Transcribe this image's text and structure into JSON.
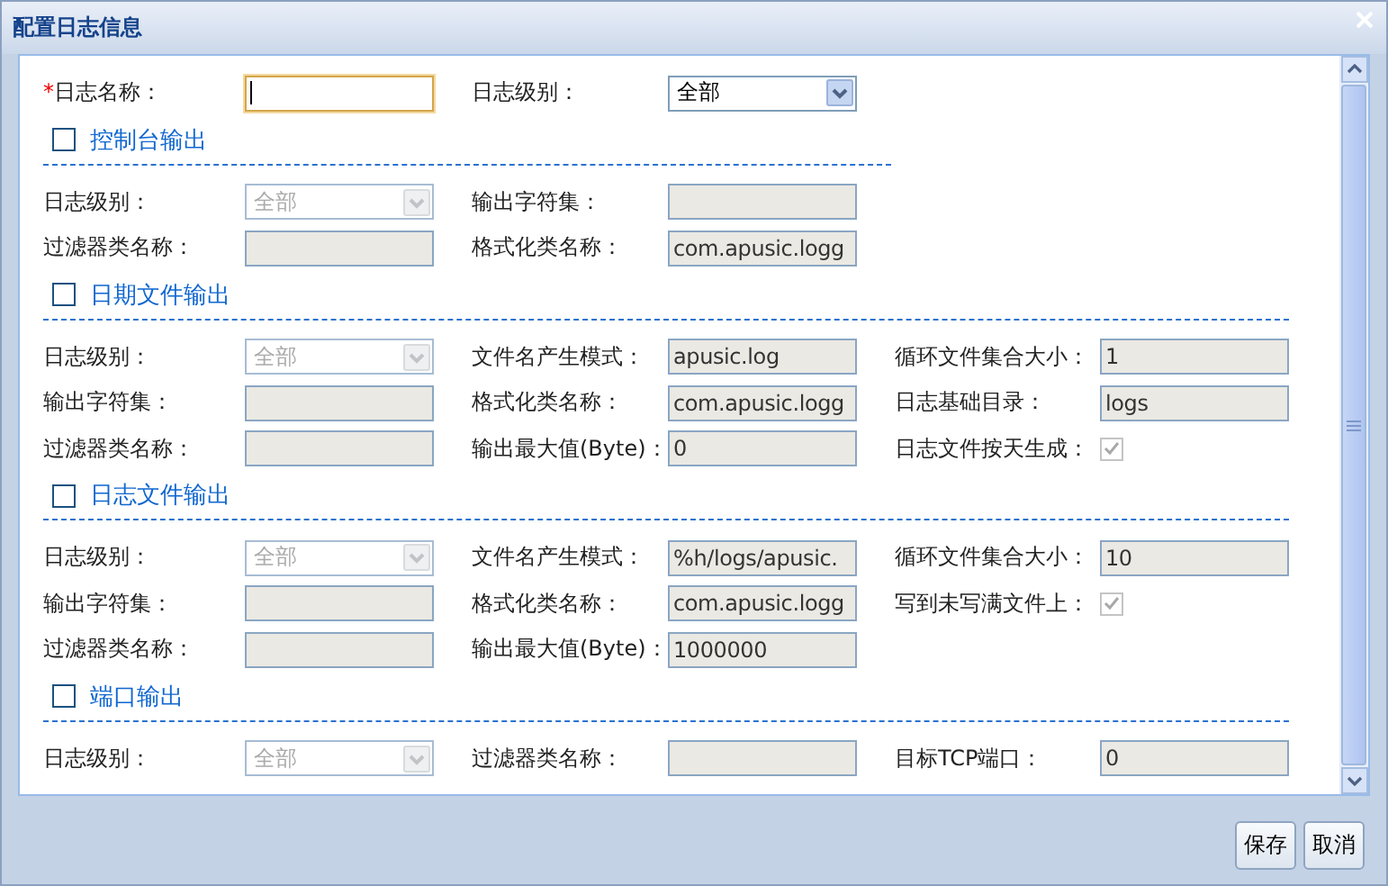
{
  "window": {
    "title": "配置日志信息"
  },
  "name_field": {
    "label": "日志名称：",
    "required_mark": "*",
    "focused": true
  },
  "level_select": {
    "label": "日志级别：",
    "value": "全部"
  },
  "sections": [
    {
      "title": "控制台输出",
      "checked": false,
      "rows": [
        [
          {
            "kind": "select",
            "label": "日志级别：",
            "value": "全部",
            "disabled": true
          },
          {
            "kind": "text",
            "label": "输出字符集：",
            "disabled": true
          }
        ],
        [
          {
            "kind": "text",
            "label": "过滤器类名称：",
            "disabled": true
          },
          {
            "kind": "text",
            "label": "格式化类名称：",
            "value": "com.apusic.logg",
            "disabled": true
          }
        ]
      ]
    },
    {
      "title": "日期文件输出",
      "checked": false,
      "rows": [
        [
          {
            "kind": "select",
            "label": "日志级别：",
            "value": "全部",
            "disabled": true
          },
          {
            "kind": "text",
            "label": "文件名产生模式：",
            "value": "apusic.log",
            "disabled": true
          },
          {
            "kind": "text",
            "label": "循环文件集合大小：",
            "value": "1",
            "disabled": true
          }
        ],
        [
          {
            "kind": "text",
            "label": "输出字符集：",
            "disabled": true
          },
          {
            "kind": "text",
            "label": "格式化类名称：",
            "value": "com.apusic.logg",
            "disabled": true
          },
          {
            "kind": "text",
            "label": "日志基础目录：",
            "value": "logs",
            "disabled": true
          }
        ],
        [
          {
            "kind": "text",
            "label": "过滤器类名称：",
            "disabled": true
          },
          {
            "kind": "text",
            "label": "输出最大值(Byte)：",
            "value": "0",
            "disabled": true
          },
          {
            "kind": "checkbox",
            "label": "日志文件按天生成：",
            "checked": true,
            "disabled": true
          }
        ]
      ]
    },
    {
      "title": "日志文件输出",
      "checked": false,
      "rows": [
        [
          {
            "kind": "select",
            "label": "日志级别：",
            "value": "全部",
            "disabled": true
          },
          {
            "kind": "text",
            "label": "文件名产生模式：",
            "value": "%h/logs/apusic.",
            "disabled": true
          },
          {
            "kind": "text",
            "label": "循环文件集合大小：",
            "value": "10",
            "disabled": true
          }
        ],
        [
          {
            "kind": "text",
            "label": "输出字符集：",
            "disabled": true
          },
          {
            "kind": "text",
            "label": "格式化类名称：",
            "value": "com.apusic.logg",
            "disabled": true
          },
          {
            "kind": "checkbox",
            "label": "写到未写满文件上：",
            "checked": true,
            "disabled": true
          }
        ],
        [
          {
            "kind": "text",
            "label": "过滤器类名称：",
            "disabled": true
          },
          {
            "kind": "text",
            "label": "输出最大值(Byte)：",
            "value": "1000000",
            "disabled": true
          }
        ]
      ]
    },
    {
      "title": "端口输出",
      "checked": false,
      "rows": [
        [
          {
            "kind": "select",
            "label": "日志级别：",
            "value": "全部",
            "disabled": true
          },
          {
            "kind": "text",
            "label": "过滤器类名称：",
            "disabled": true
          },
          {
            "kind": "text",
            "label": "目标TCP端口：",
            "value": "0",
            "disabled": true
          }
        ]
      ]
    }
  ],
  "buttons": [
    {
      "label": "保存"
    },
    {
      "label": "取消"
    }
  ]
}
